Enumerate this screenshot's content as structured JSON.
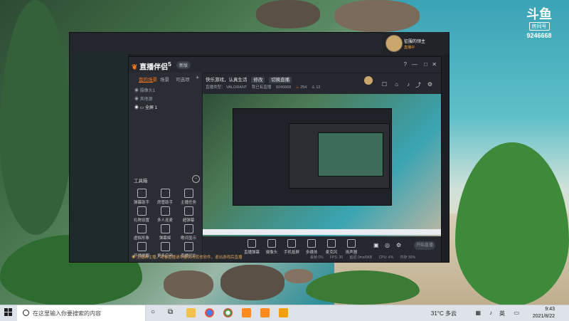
{
  "desktop": {
    "badge": {
      "logo": "斗鱼",
      "label": "房间号",
      "room_number": "9246668"
    }
  },
  "streamer_card": {
    "name": "征服的领主",
    "status": "直播中",
    "level": "61"
  },
  "app": {
    "brand": "直播伴侣",
    "brand_suffix": "5",
    "pill": "新版",
    "window_buttons": [
      "?",
      "—",
      "□",
      "✕"
    ],
    "sidebar": {
      "tabs": [
        "我的场景",
        "场景",
        "可选项"
      ],
      "add": "+",
      "sources": [
        "摄像头1",
        "其他源",
        "全屏 1"
      ],
      "tools_title": "工具箱",
      "tools_more": "...",
      "tools": [
        "弹幕助手",
        "房管助手",
        "主播任务",
        "礼物设置",
        "多人连麦",
        "超弹幕",
        "虚拟形象",
        "弹幕姬",
        "歌词显示",
        "开播提醒",
        "更多应用",
        "直播切片"
      ]
    },
    "main": {
      "stream_title": "快乐游戏，认真生活",
      "edit": "修改",
      "category_btn": "切换直播",
      "category_label": "直播类型：",
      "category": "VALORANT",
      "recent": "我已有直播",
      "room_id": "9246668",
      "followers": "254",
      "viewers": "12"
    },
    "controls": [
      "直播弹幕",
      "摄像头",
      "手机投屏",
      "多媒体",
      "麦克风",
      "扬声器"
    ],
    "start_live": "开始直播",
    "notice": "主播新主播，观看直播请尽量关闭其他软件，退出游戏后直播",
    "status": [
      "丢帧 0%",
      "FPS: 30",
      "延迟 0ms/0KB",
      "CPU: 4%",
      "内存 30%",
      "码率 0kb"
    ]
  },
  "taskbar": {
    "search_placeholder": "在这里输入你要搜索的内容",
    "weather": "31°C  多云",
    "lang": "英",
    "time": "9:43",
    "date": "2021/8/22"
  }
}
